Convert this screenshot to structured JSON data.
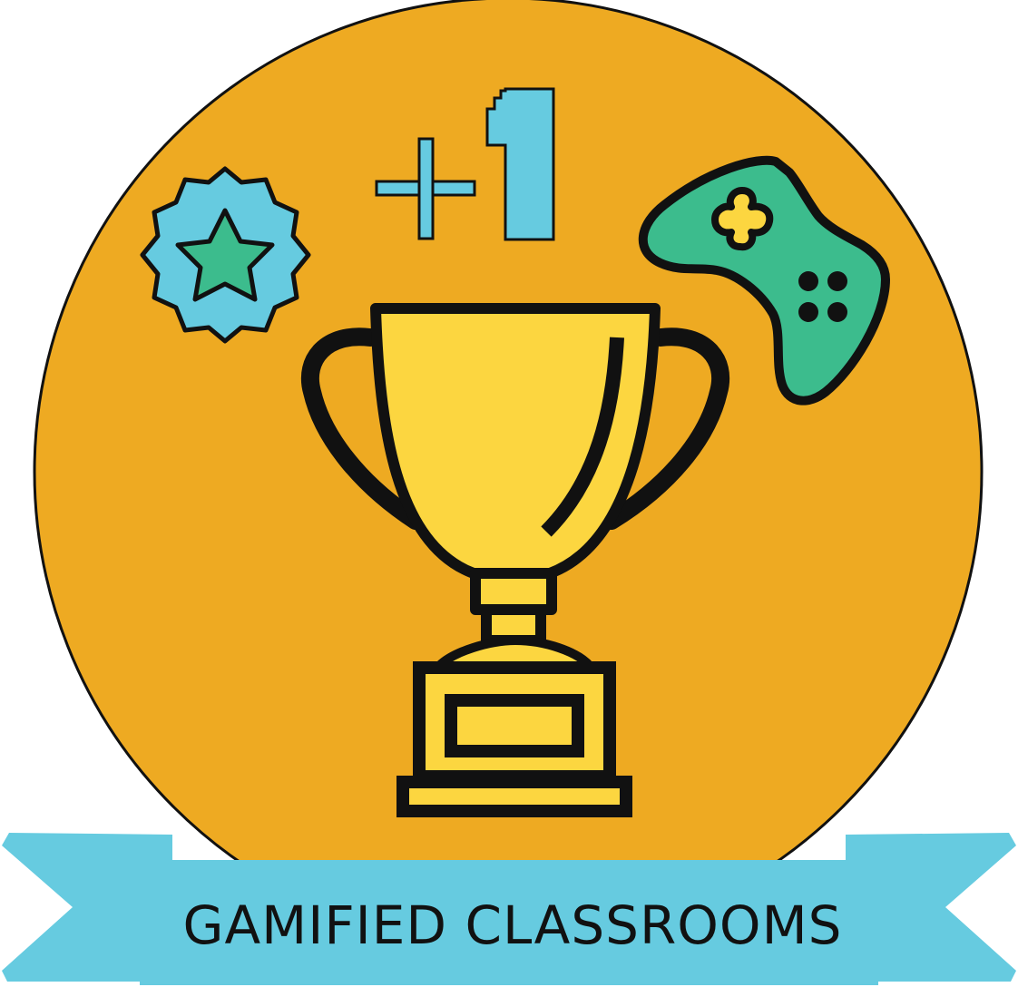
{
  "badge": {
    "title": "GAMIFIED CLASSROOMS",
    "points_label": "+1"
  },
  "icons": [
    "star-badge-icon",
    "plus-one-icon",
    "game-controller-icon",
    "trophy-icon",
    "ribbon-banner"
  ],
  "colors": {
    "background_circle": "#EEAA22",
    "trophy": "#FCD640",
    "ribbon": "#66CBE0",
    "badge_outer": "#66CBE0",
    "badge_star": "#3CBC8D",
    "controller": "#3CBC8D",
    "controller_cross": "#FCD640",
    "outline": "#111111"
  }
}
